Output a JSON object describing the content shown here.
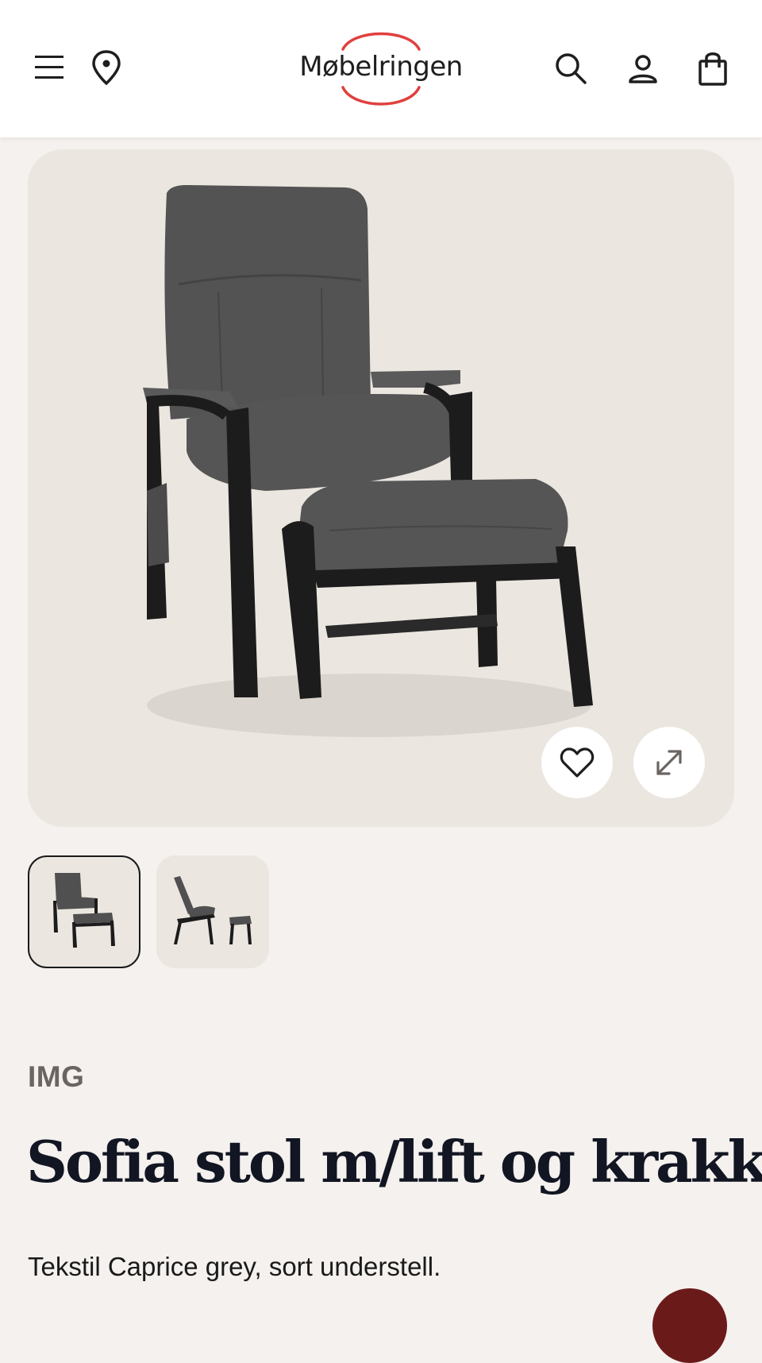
{
  "header": {
    "logo_text": "Møbelringen",
    "icons": [
      "menu-icon",
      "location-pin-icon",
      "search-icon",
      "account-icon",
      "shopping-bag-icon"
    ]
  },
  "gallery": {
    "main_image_alt": "Sofia stol m/lift og krakk",
    "favorite_icon": "heart-icon",
    "expand_icon": "expand-icon",
    "thumbnail_count": 2,
    "selected_thumbnail": 1
  },
  "product": {
    "brand": "IMG",
    "title": "Sofia stol m/lift og krakk",
    "description": "Tekstil Caprice grey, sort understell."
  },
  "colors": {
    "accent_red": "#e0403e",
    "background": "#f4f1ee",
    "image_bg": "#ebe6e0",
    "fabric": "#545454",
    "frame": "#1c1c1c"
  }
}
